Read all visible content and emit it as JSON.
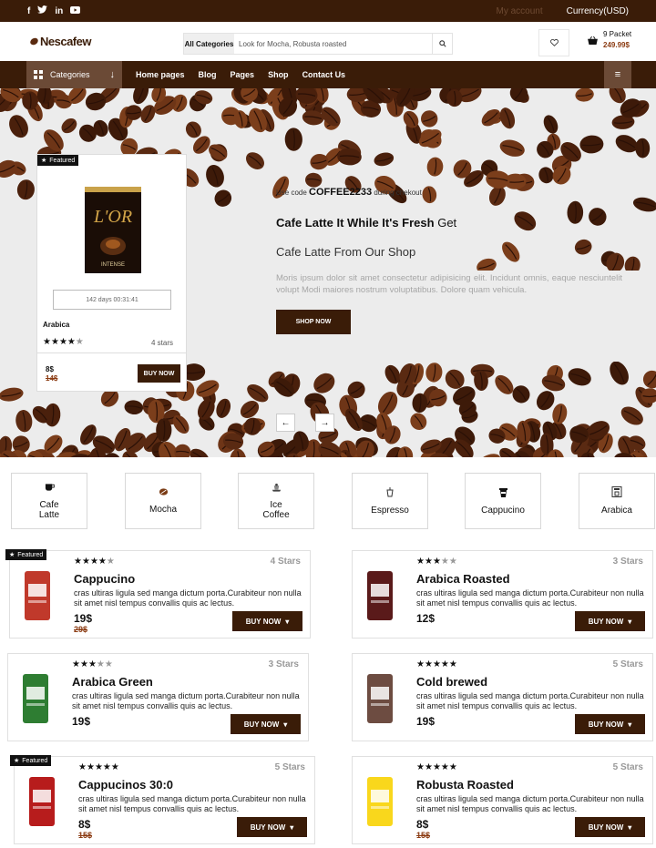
{
  "topbar": {
    "social": [
      "f",
      "t",
      "in",
      "yt"
    ],
    "account": "My account",
    "currency": "Currency(USD)"
  },
  "header": {
    "logo": "Nescafew",
    "search_category": "All Categories",
    "search_placeholder": "Look for Mocha, Robusta roasted",
    "cart_count": "9 Packet",
    "cart_total": "249.99$"
  },
  "nav": {
    "categories_label": "Categories",
    "links": [
      "Home pages",
      "Blog",
      "Pages",
      "Shop",
      "Contact Us"
    ]
  },
  "hero": {
    "featured_badge": "Featured",
    "timer": "142 days 00:31:41",
    "product_name": "Arabica",
    "rating": 4,
    "stars_label": "4 stars",
    "price": "8$",
    "old_price": "14$",
    "buy_label": "BUY NOW",
    "code_prefix": "Use code",
    "code": "COFFEE2233",
    "code_suffix": "during chekout",
    "headline_bold": "Cafe Latte It While It's Fresh",
    "headline_rest": "Get",
    "subheadline": "Cafe Latte From Our Shop",
    "body": "Moris ipsum dolor sit amet consectetur adipisicing elit. Incidunt omnis, eaque nesciuntelit volupt Modi maiores nostrum voluptatibus. Dolore quam vehicula.",
    "shop_label": "SHOP NOW",
    "prev": "←",
    "next": "→"
  },
  "categories": [
    {
      "label": "Cafe Latte",
      "icon": "coffee-cup-icon"
    },
    {
      "label": "Mocha",
      "icon": "coffee-bean-icon"
    },
    {
      "label": "Ice Coffee",
      "icon": "ice-coffee-icon"
    },
    {
      "label": "Espresso",
      "icon": "espresso-glass-icon"
    },
    {
      "label": "Cappucino",
      "icon": "takeaway-cup-icon"
    },
    {
      "label": "Arabica",
      "icon": "coffee-machine-icon"
    }
  ],
  "products": [
    {
      "name": "Cappucino",
      "rating": 4,
      "stars_label": "4 Stars",
      "price": "19$",
      "old_price": "29$",
      "featured": "Featured",
      "color": "#c0392b"
    },
    {
      "name": "Arabica Roasted",
      "rating": 3,
      "stars_label": "3 Stars",
      "price": "12$",
      "old_price": "",
      "featured": "",
      "color": "#5a1a1a"
    },
    {
      "name": "Arabica Green",
      "rating": 3,
      "stars_label": "3 Stars",
      "price": "19$",
      "old_price": "",
      "featured": "",
      "color": "#2e7d32"
    },
    {
      "name": "Cold brewed",
      "rating": 5,
      "stars_label": "5 Stars",
      "price": "19$",
      "old_price": "",
      "featured": "",
      "color": "#6d4c41"
    },
    {
      "name": "Cappucinos 30:0",
      "rating": 5,
      "stars_label": "5 Stars",
      "price": "8$",
      "old_price": "15$",
      "featured": "Featured",
      "color": "#b71c1c"
    },
    {
      "name": "Robusta Roasted",
      "rating": 5,
      "stars_label": "5 Stars",
      "price": "8$",
      "old_price": "15$",
      "featured": "",
      "color": "#f9d71c"
    }
  ],
  "product_description": "cras ultiras ligula sed manga dictum porta.Curabiteur non nulla sit amet nisl tempus convallis quis ac lectus.",
  "buy_label": "BUY NOW"
}
